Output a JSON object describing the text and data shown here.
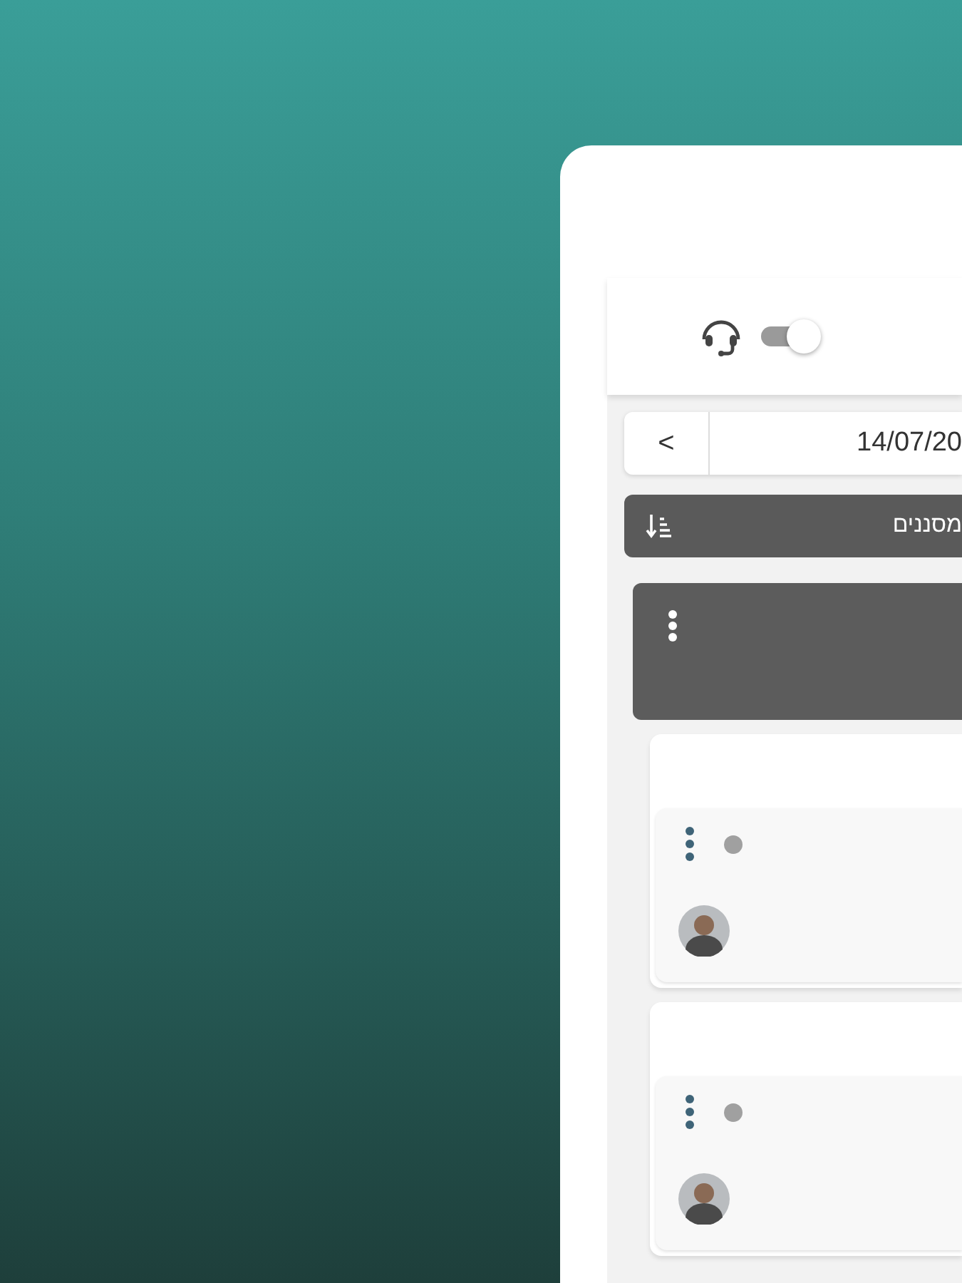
{
  "header": {
    "switch": {
      "on": false
    }
  },
  "date_bar": {
    "prev": "<",
    "date": "14/07/20"
  },
  "filter_bar": {
    "label": "מסננים"
  },
  "cards": [
    {
      "color": "#a0a0a0"
    },
    {
      "color": "#a0a0a0"
    }
  ]
}
